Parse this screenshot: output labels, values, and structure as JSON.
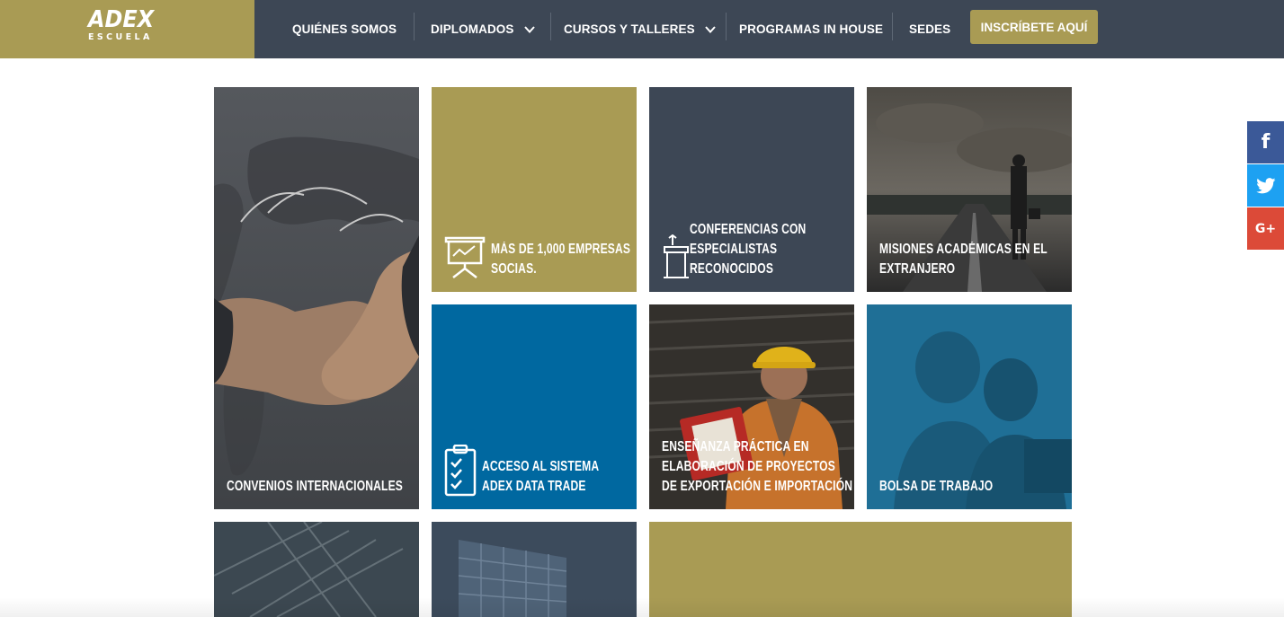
{
  "brand": {
    "logo_main": "ADEX",
    "logo_sub": "ESCUELA"
  },
  "nav": {
    "items": [
      {
        "label": "QUIÉNES SOMOS"
      },
      {
        "label": "DIPLOMADOS"
      },
      {
        "label": "CURSOS Y TALLERES"
      },
      {
        "label": "PROGRAMAS IN HOUSE"
      },
      {
        "label": "SEDES"
      }
    ],
    "cta_label": "INSCRÍBETE AQUÍ"
  },
  "tiles": [
    {
      "label": "CONVENIOS INTERNACIONALES",
      "color": "#4a4d52"
    },
    {
      "label": "MÁS DE 1,000 EMPRESAS SOCIAS.",
      "color": "#a99b54",
      "icon": "presentation-board-icon"
    },
    {
      "label": "CONFERENCIAS CON ESPECIALISTAS RECONOCIDOS",
      "color": "#3d4755",
      "icon": "podium-icon"
    },
    {
      "label": "MISIONES ACADÉMICAS EN EL EXTRANJERO",
      "color": "#3a3a3a"
    },
    {
      "label": "ACCESO AL SISTEMA ADEX DATA TRADE",
      "color": "#0068a0",
      "icon": "clipboard-checklist-icon"
    },
    {
      "label": "ENSEÑANZA PRÁCTICA EN ELABORACIÓN DE PROYECTOS DE EXPORTACIÓN E IMPORTACIÓN",
      "color": "#3a3530"
    },
    {
      "label": "BOLSA DE TRABAJO",
      "color": "#1e6e94"
    },
    {
      "label": "",
      "color": "#4a5560"
    },
    {
      "label": "",
      "color": "#3b4a5a"
    },
    {
      "label": "",
      "color": "#a99b54"
    }
  ],
  "social": {
    "facebook": "f",
    "twitter": "twitter-bird-icon",
    "googleplus": "G+"
  },
  "colors": {
    "gold": "#a99b54",
    "slate": "#3d4755",
    "blue": "#0068a0"
  }
}
